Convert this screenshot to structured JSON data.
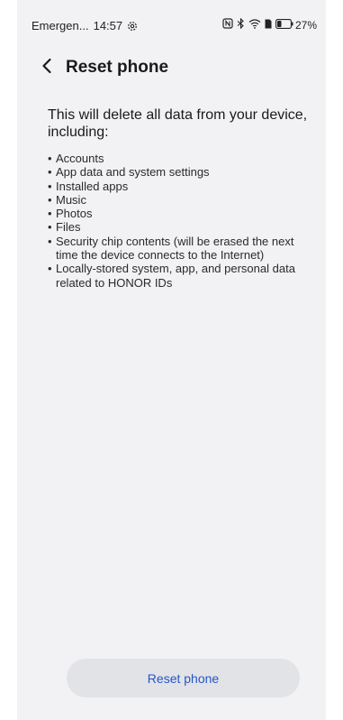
{
  "status_bar": {
    "carrier": "Emergen...",
    "time": "14:57",
    "battery": "27%",
    "icons": [
      "gear-icon",
      "nfc-icon",
      "bluetooth-icon",
      "wifi-icon",
      "sim-icon",
      "battery-icon"
    ]
  },
  "header": {
    "title": "Reset phone",
    "back_icon": "back-arrow-icon"
  },
  "content": {
    "intro": "This will delete all data from your device, including:",
    "items": [
      "Accounts",
      "App data and system settings",
      "Installed apps",
      "Music",
      "Photos",
      "Files",
      "Security chip contents (will be erased the next time the device connects to the Internet)",
      "Locally-stored system, app, and personal data related to HONOR IDs"
    ]
  },
  "footer": {
    "reset_label": "Reset phone"
  },
  "colors": {
    "background": "#f2f2f4",
    "button_bg": "#e2e3e6",
    "accent": "#2556c7"
  }
}
